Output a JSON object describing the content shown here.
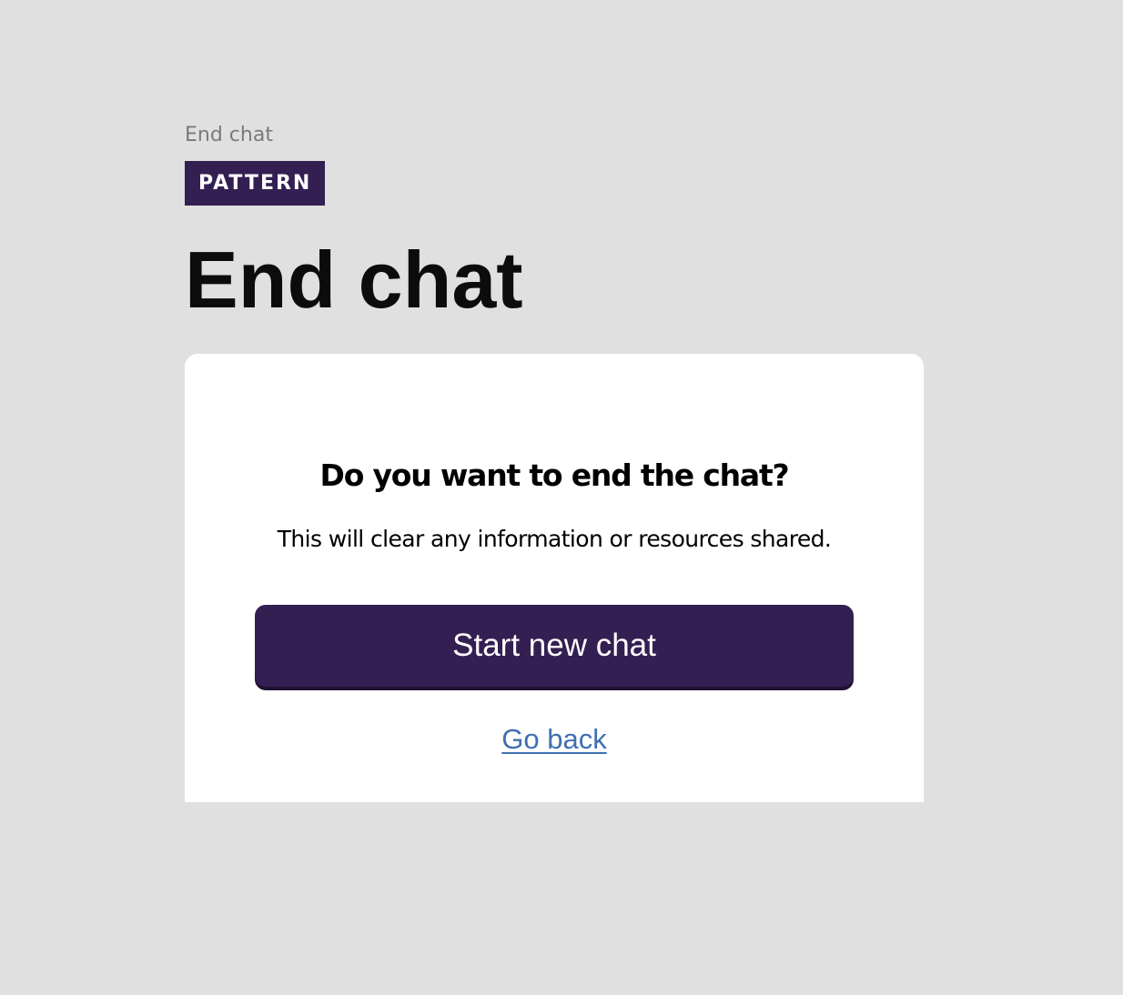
{
  "header": {
    "breadcrumb": "End chat",
    "tag_label": "PATTERN",
    "page_title": "End chat"
  },
  "dialog": {
    "heading": "Do you want to end the chat?",
    "body_text": "This will clear any information or resources shared.",
    "primary_button_label": "Start new chat",
    "back_link_label": "Go back"
  },
  "colors": {
    "background": "#e0e0e0",
    "brand_purple": "#341f52",
    "link_blue": "#3f6fb1",
    "card_background": "#ffffff"
  }
}
